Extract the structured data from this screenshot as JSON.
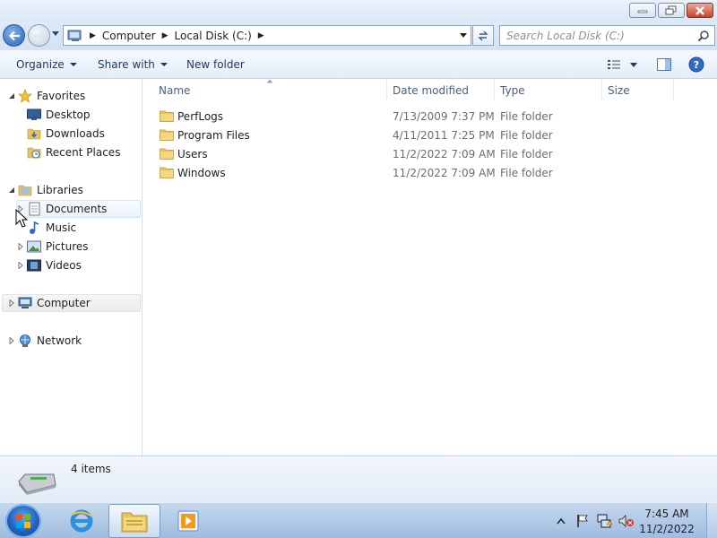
{
  "titlebar": {
    "buttons": [
      "minimize",
      "restore",
      "close"
    ]
  },
  "address": {
    "crumbs": [
      "Computer",
      "Local Disk (C:)"
    ],
    "search_placeholder": "Search Local Disk (C:)"
  },
  "toolbar": {
    "organize": "Organize",
    "share_with": "Share with",
    "new_folder": "New folder"
  },
  "nav": {
    "favorites": "Favorites",
    "desktop": "Desktop",
    "downloads": "Downloads",
    "recent_places": "Recent Places",
    "libraries": "Libraries",
    "documents": "Documents",
    "music": "Music",
    "pictures": "Pictures",
    "videos": "Videos",
    "computer": "Computer",
    "network": "Network"
  },
  "columns": {
    "name": "Name",
    "date": "Date modified",
    "type": "Type",
    "size": "Size"
  },
  "files": [
    {
      "name": "PerfLogs",
      "date": "7/13/2009 7:37 PM",
      "type": "File folder"
    },
    {
      "name": "Program Files",
      "date": "4/11/2011 7:25 PM",
      "type": "File folder"
    },
    {
      "name": "Users",
      "date": "11/2/2022 7:09 AM",
      "type": "File folder"
    },
    {
      "name": "Windows",
      "date": "11/2/2022 7:09 AM",
      "type": "File folder"
    }
  ],
  "details": {
    "count": "4 items"
  },
  "taskbar": {
    "time": "7:45 AM",
    "date": "11/2/2022"
  },
  "colors": {
    "folder": "#e8c35a",
    "selection": "#e9f2fc",
    "taskbar": "#b3cae6"
  }
}
